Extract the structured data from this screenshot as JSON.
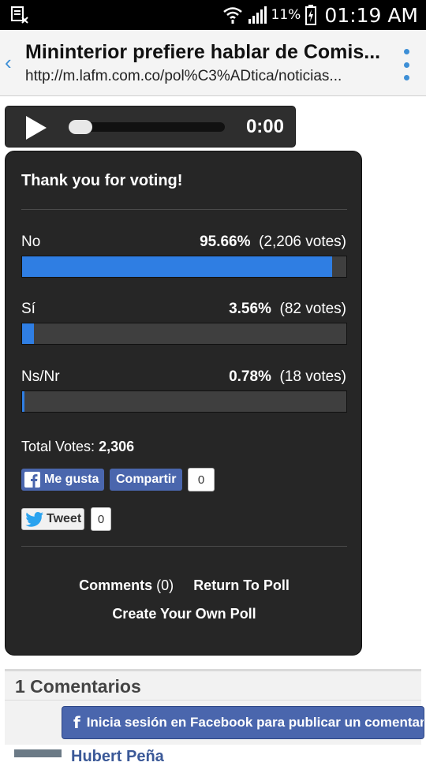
{
  "status_bar": {
    "battery_percent": "11%",
    "time": "01:19 AM"
  },
  "browser": {
    "title": "Mininterior prefiere hablar de Comis...",
    "url": "http://m.lafm.com.co/pol%C3%ADtica/noticias..."
  },
  "audio": {
    "time": "0:00"
  },
  "poll": {
    "heading": "Thank you for voting!",
    "options": [
      {
        "label": "No",
        "percent": "95.66%",
        "votes": "(2,206 votes)",
        "fraction": 0.9566
      },
      {
        "label": "Sí",
        "percent": "3.56%",
        "votes": "(82 votes)",
        "fraction": 0.0356
      },
      {
        "label": "Ns/Nr",
        "percent": "0.78%",
        "votes": "(18 votes)",
        "fraction": 0.0078
      }
    ],
    "total_label": "Total Votes:",
    "total_value": "2,306",
    "like_label": "Me gusta",
    "share_label": "Compartir",
    "share_count": "0",
    "tweet_label": "Tweet",
    "tweet_count": "0",
    "comments_label": "Comments",
    "comments_count": "(0)",
    "return_label": "Return To Poll",
    "create_label": "Create Your Own Poll"
  },
  "comments": {
    "title": "1 Comentarios",
    "fb_login_label": "Inicia sesión en Facebook para publicar un comentario",
    "commenter": "Hubert Peña"
  },
  "colors": {
    "accent": "#2f7ee3",
    "facebook": "#4a66ad",
    "panel": "#262626"
  }
}
